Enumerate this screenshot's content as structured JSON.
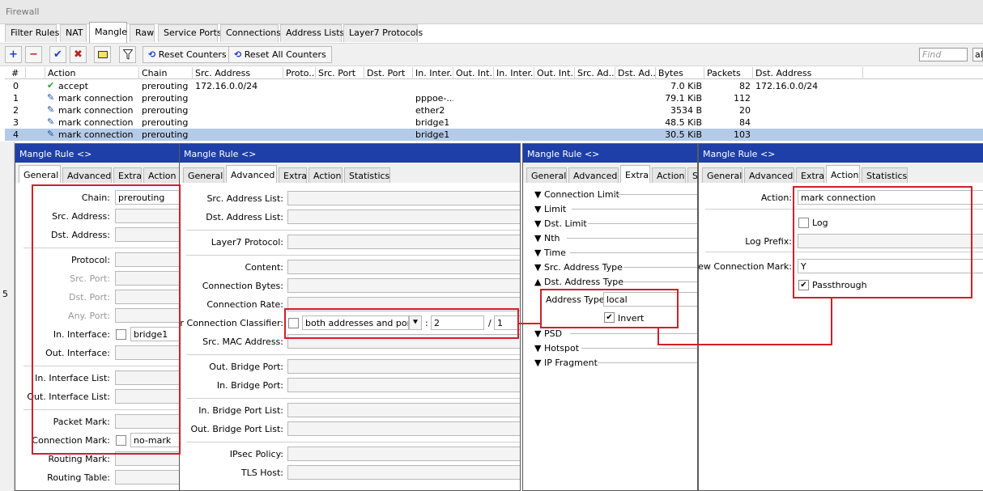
{
  "window_title": "Firewall",
  "main_tabs": [
    "Filter Rules",
    "NAT",
    "Mangle",
    "Raw",
    "Service Ports",
    "Connections",
    "Address Lists",
    "Layer7 Protocols"
  ],
  "toolbar": {
    "reset_counters": "Reset Counters",
    "reset_all_counters": "Reset All Counters",
    "find_placeholder": "Find",
    "filter_value": "all"
  },
  "columns": [
    "#",
    "Action",
    "Chain",
    "Src. Address",
    "Proto...",
    "Src. Port",
    "Dst. Port",
    "In. Inter...",
    "Out. Int...",
    "In. Inter...",
    "Out. Int...",
    "Src. Ad...",
    "Dst. Ad...",
    "Bytes",
    "Packets",
    "Dst. Address"
  ],
  "rows": [
    {
      "num": "0",
      "action": "accept",
      "chain": "prerouting",
      "src": "172.16.0.0/24",
      "in_if": "",
      "bytes": "7.0 KiB",
      "packets": "82",
      "dst": "172.16.0.0/24",
      "icon": "check-icon",
      "selected": false
    },
    {
      "num": "1",
      "action": "mark connection",
      "chain": "prerouting",
      "src": "",
      "in_if": "pppoe-...",
      "bytes": "79.1 KiB",
      "packets": "112",
      "dst": "",
      "icon": "pencil-icon",
      "selected": false
    },
    {
      "num": "2",
      "action": "mark connection",
      "chain": "prerouting",
      "src": "",
      "in_if": "ether2",
      "bytes": "3534 B",
      "packets": "20",
      "dst": "",
      "icon": "pencil-icon",
      "selected": false
    },
    {
      "num": "3",
      "action": "mark connection",
      "chain": "prerouting",
      "src": "",
      "in_if": "bridge1",
      "bytes": "48.5 KiB",
      "packets": "84",
      "dst": "",
      "icon": "pencil-icon",
      "selected": false
    },
    {
      "num": "4",
      "action": "mark connection",
      "chain": "prerouting",
      "src": "",
      "in_if": "bridge1",
      "bytes": "30.5 KiB",
      "packets": "103",
      "dst": "",
      "icon": "pencil-icon",
      "selected": true
    }
  ],
  "status_left": "5",
  "dialog_title": "Mangle Rule <>",
  "w1": {
    "tabs": [
      "General",
      "Advanced",
      "Extra",
      "Action"
    ],
    "chain_label": "Chain:",
    "chain_value": "prerouting",
    "src_address_label": "Src. Address:",
    "dst_address_label": "Dst. Address:",
    "protocol_label": "Protocol:",
    "src_port_label": "Src. Port:",
    "dst_port_label": "Dst. Port:",
    "any_port_label": "Any. Port:",
    "in_interface_label": "In. Interface:",
    "in_interface_value": "bridge1",
    "out_interface_label": "Out. Interface:",
    "in_interface_list_label": "In. Interface List:",
    "out_interface_list_label": "Out. Interface List:",
    "packet_mark_label": "Packet Mark:",
    "connection_mark_label": "Connection Mark:",
    "connection_mark_value": "no-mark",
    "routing_mark_label": "Routing Mark:",
    "routing_table_label": "Routing Table:"
  },
  "w2": {
    "tabs": [
      "General",
      "Advanced",
      "Extra",
      "Action",
      "Statistics"
    ],
    "src_address_list_label": "Src. Address List:",
    "dst_address_list_label": "Dst. Address List:",
    "layer7_label": "Layer7 Protocol:",
    "content_label": "Content:",
    "connection_bytes_label": "Connection Bytes:",
    "connection_rate_label": "Connection Rate:",
    "pcc_label": "Per Connection Classifier:",
    "pcc_mode": "both addresses and ports",
    "pcc_sep1": ":",
    "pcc_a": "2",
    "pcc_sep2": "/",
    "pcc_b": "1",
    "src_mac_label": "Src. MAC Address:",
    "out_bridge_port_label": "Out. Bridge Port:",
    "in_bridge_port_label": "In. Bridge Port:",
    "in_bridge_port_list_label": "In. Bridge Port List:",
    "out_bridge_port_list_label": "Out. Bridge Port List:",
    "ipsec_policy_label": "IPsec Policy:",
    "tls_host_label": "TLS Host:"
  },
  "w3": {
    "tabs": [
      "General",
      "Advanced",
      "Extra",
      "Action",
      "St"
    ],
    "sections": [
      "Connection Limit",
      "Limit",
      "Dst. Limit",
      "Nth",
      "Time",
      "Src. Address Type",
      "Dst. Address Type"
    ],
    "address_type_label": "Address Type:",
    "address_type_value": "local",
    "invert_label": "Invert",
    "sections_after": [
      "PSD",
      "Hotspot",
      "IP Fragment"
    ]
  },
  "w4": {
    "tabs": [
      "General",
      "Advanced",
      "Extra",
      "Action",
      "Statistics"
    ],
    "action_label": "Action:",
    "action_value": "mark connection",
    "log_label": "Log",
    "log_prefix_label": "Log Prefix:",
    "new_connection_mark_label": "New Connection Mark:",
    "new_connection_mark_value": "Y",
    "passthrough_label": "Passthrough"
  },
  "colors": {
    "accent_title": "#1e3fa8",
    "highlight": "#d0202a",
    "selected_row": "#b4cbe8"
  }
}
